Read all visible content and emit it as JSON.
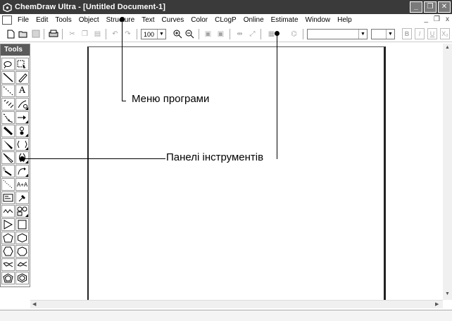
{
  "window": {
    "title": "ChemDraw Ultra - [Untitled Document-1]"
  },
  "menu": {
    "items": [
      "File",
      "Edit",
      "Tools",
      "Object",
      "Structure",
      "Text",
      "Curves",
      "Color",
      "CLogP",
      "Online",
      "Estimate",
      "Window",
      "Help"
    ],
    "mdi_controls": [
      "_",
      " ",
      "x"
    ]
  },
  "toolbar": {
    "zoom_value": "100",
    "font_value": "",
    "size_value": "",
    "format_buttons": [
      "B",
      "I",
      "U",
      "X₂"
    ]
  },
  "palette": {
    "title": "Tools"
  },
  "callouts": {
    "menu_label": "Меню програми",
    "toolbar_label": "Панелі інструментів"
  }
}
